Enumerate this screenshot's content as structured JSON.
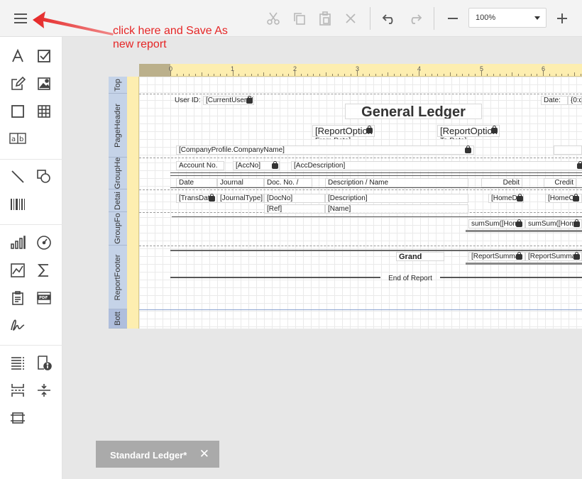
{
  "toolbar": {
    "menu_icon": "hamburger-menu-icon",
    "zoom_value": "100%"
  },
  "annotation": {
    "line1": "click here and Save As",
    "line2": "new report",
    "color": "#e52626"
  },
  "ruler": {
    "numbers": [
      "0",
      "1",
      "2",
      "3",
      "4",
      "5",
      "6"
    ]
  },
  "bands": {
    "top": "Top",
    "page_header": "PageHeader",
    "group_header": "GroupHe",
    "detail": "Detai",
    "group_footer": "GroupFo",
    "report_footer": "ReportFooter",
    "bottom": "Bott"
  },
  "report": {
    "user_id_label": "User ID:",
    "current_user": "[CurrentUser.U",
    "date_label": "Date:",
    "date_value": "{0:d",
    "title": "General Ledger",
    "report_option_from": "[ReportOption",
    "report_option_from_sub": "From Date]",
    "report_option_to": "[ReportOption",
    "report_option_to_sub": "To Date]",
    "company_name": "[CompanyProfile.CompanyName]",
    "account_no_label": "Account No.",
    "acc_no": "[AccNo]",
    "acc_description": "[AccDescription]",
    "col_date": "Date",
    "col_journal": "Journal",
    "col_doc_no": "Doc. No. /",
    "col_description": "Description / Name",
    "col_debit": "Debit",
    "col_credit": "Credit",
    "trans_date": "[TransDat",
    "journal_type": "[JournalType]",
    "doc_no": "[DocNo]",
    "description": "[Description]",
    "home_debit": "[HomeD",
    "home_credit": "[HomeC",
    "ref": "[Ref]",
    "name": "[Name]",
    "sum_debit": "sumSum([Hom",
    "sum_credit": "sumSum([Hom",
    "grand_label": "Grand",
    "report_summary_debit": "[ReportSumma",
    "report_summary_credit": "[ReportSumma",
    "end_of_report": "End of Report"
  },
  "doc_tab": {
    "label": "Standard Ledger*",
    "close": "✕"
  }
}
